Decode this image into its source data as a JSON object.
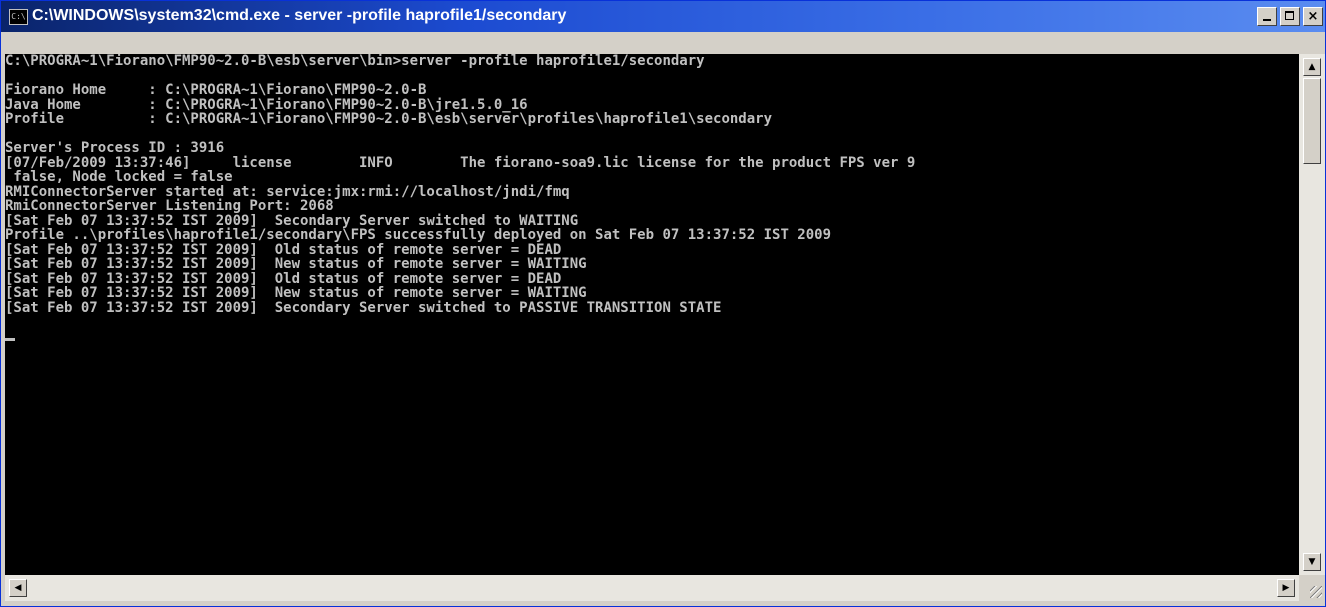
{
  "window": {
    "title": "C:\\WINDOWS\\system32\\cmd.exe - server -profile haprofile1/secondary",
    "icon_label": "C:\\"
  },
  "controls": {
    "minimize": "minimize-icon",
    "maximize": "maximize-icon",
    "close": "×"
  },
  "console": {
    "lines": [
      "C:\\PROGRA~1\\Fiorano\\FMP90~2.0-B\\esb\\server\\bin>server -profile haprofile1/secondary",
      "",
      "Fiorano Home     : C:\\PROGRA~1\\Fiorano\\FMP90~2.0-B",
      "Java Home        : C:\\PROGRA~1\\Fiorano\\FMP90~2.0-B\\jre1.5.0_16",
      "Profile          : C:\\PROGRA~1\\Fiorano\\FMP90~2.0-B\\esb\\server\\profiles\\haprofile1\\secondary",
      "",
      "Server's Process ID : 3916",
      "[07/Feb/2009 13:37:46]     license        INFO        The fiorano-soa9.lic license for the product FPS ver 9",
      " false, Node locked = false",
      "RMIConnectorServer started at: service:jmx:rmi://localhost/jndi/fmq",
      "RmiConnectorServer Listening Port: 2068",
      "[Sat Feb 07 13:37:52 IST 2009]  Secondary Server switched to WAITING",
      "Profile ..\\profiles\\haprofile1/secondary\\FPS successfully deployed on Sat Feb 07 13:37:52 IST 2009",
      "[Sat Feb 07 13:37:52 IST 2009]  Old status of remote server = DEAD",
      "[Sat Feb 07 13:37:52 IST 2009]  New status of remote server = WAITING",
      "[Sat Feb 07 13:37:52 IST 2009]  Old status of remote server = DEAD",
      "[Sat Feb 07 13:37:52 IST 2009]  New status of remote server = WAITING",
      "[Sat Feb 07 13:37:52 IST 2009]  Secondary Server switched to PASSIVE TRANSITION STATE"
    ]
  },
  "scrollbars": {
    "up_arrow": "▲",
    "down_arrow": "▼",
    "left_arrow": "◀",
    "right_arrow": "▶"
  }
}
